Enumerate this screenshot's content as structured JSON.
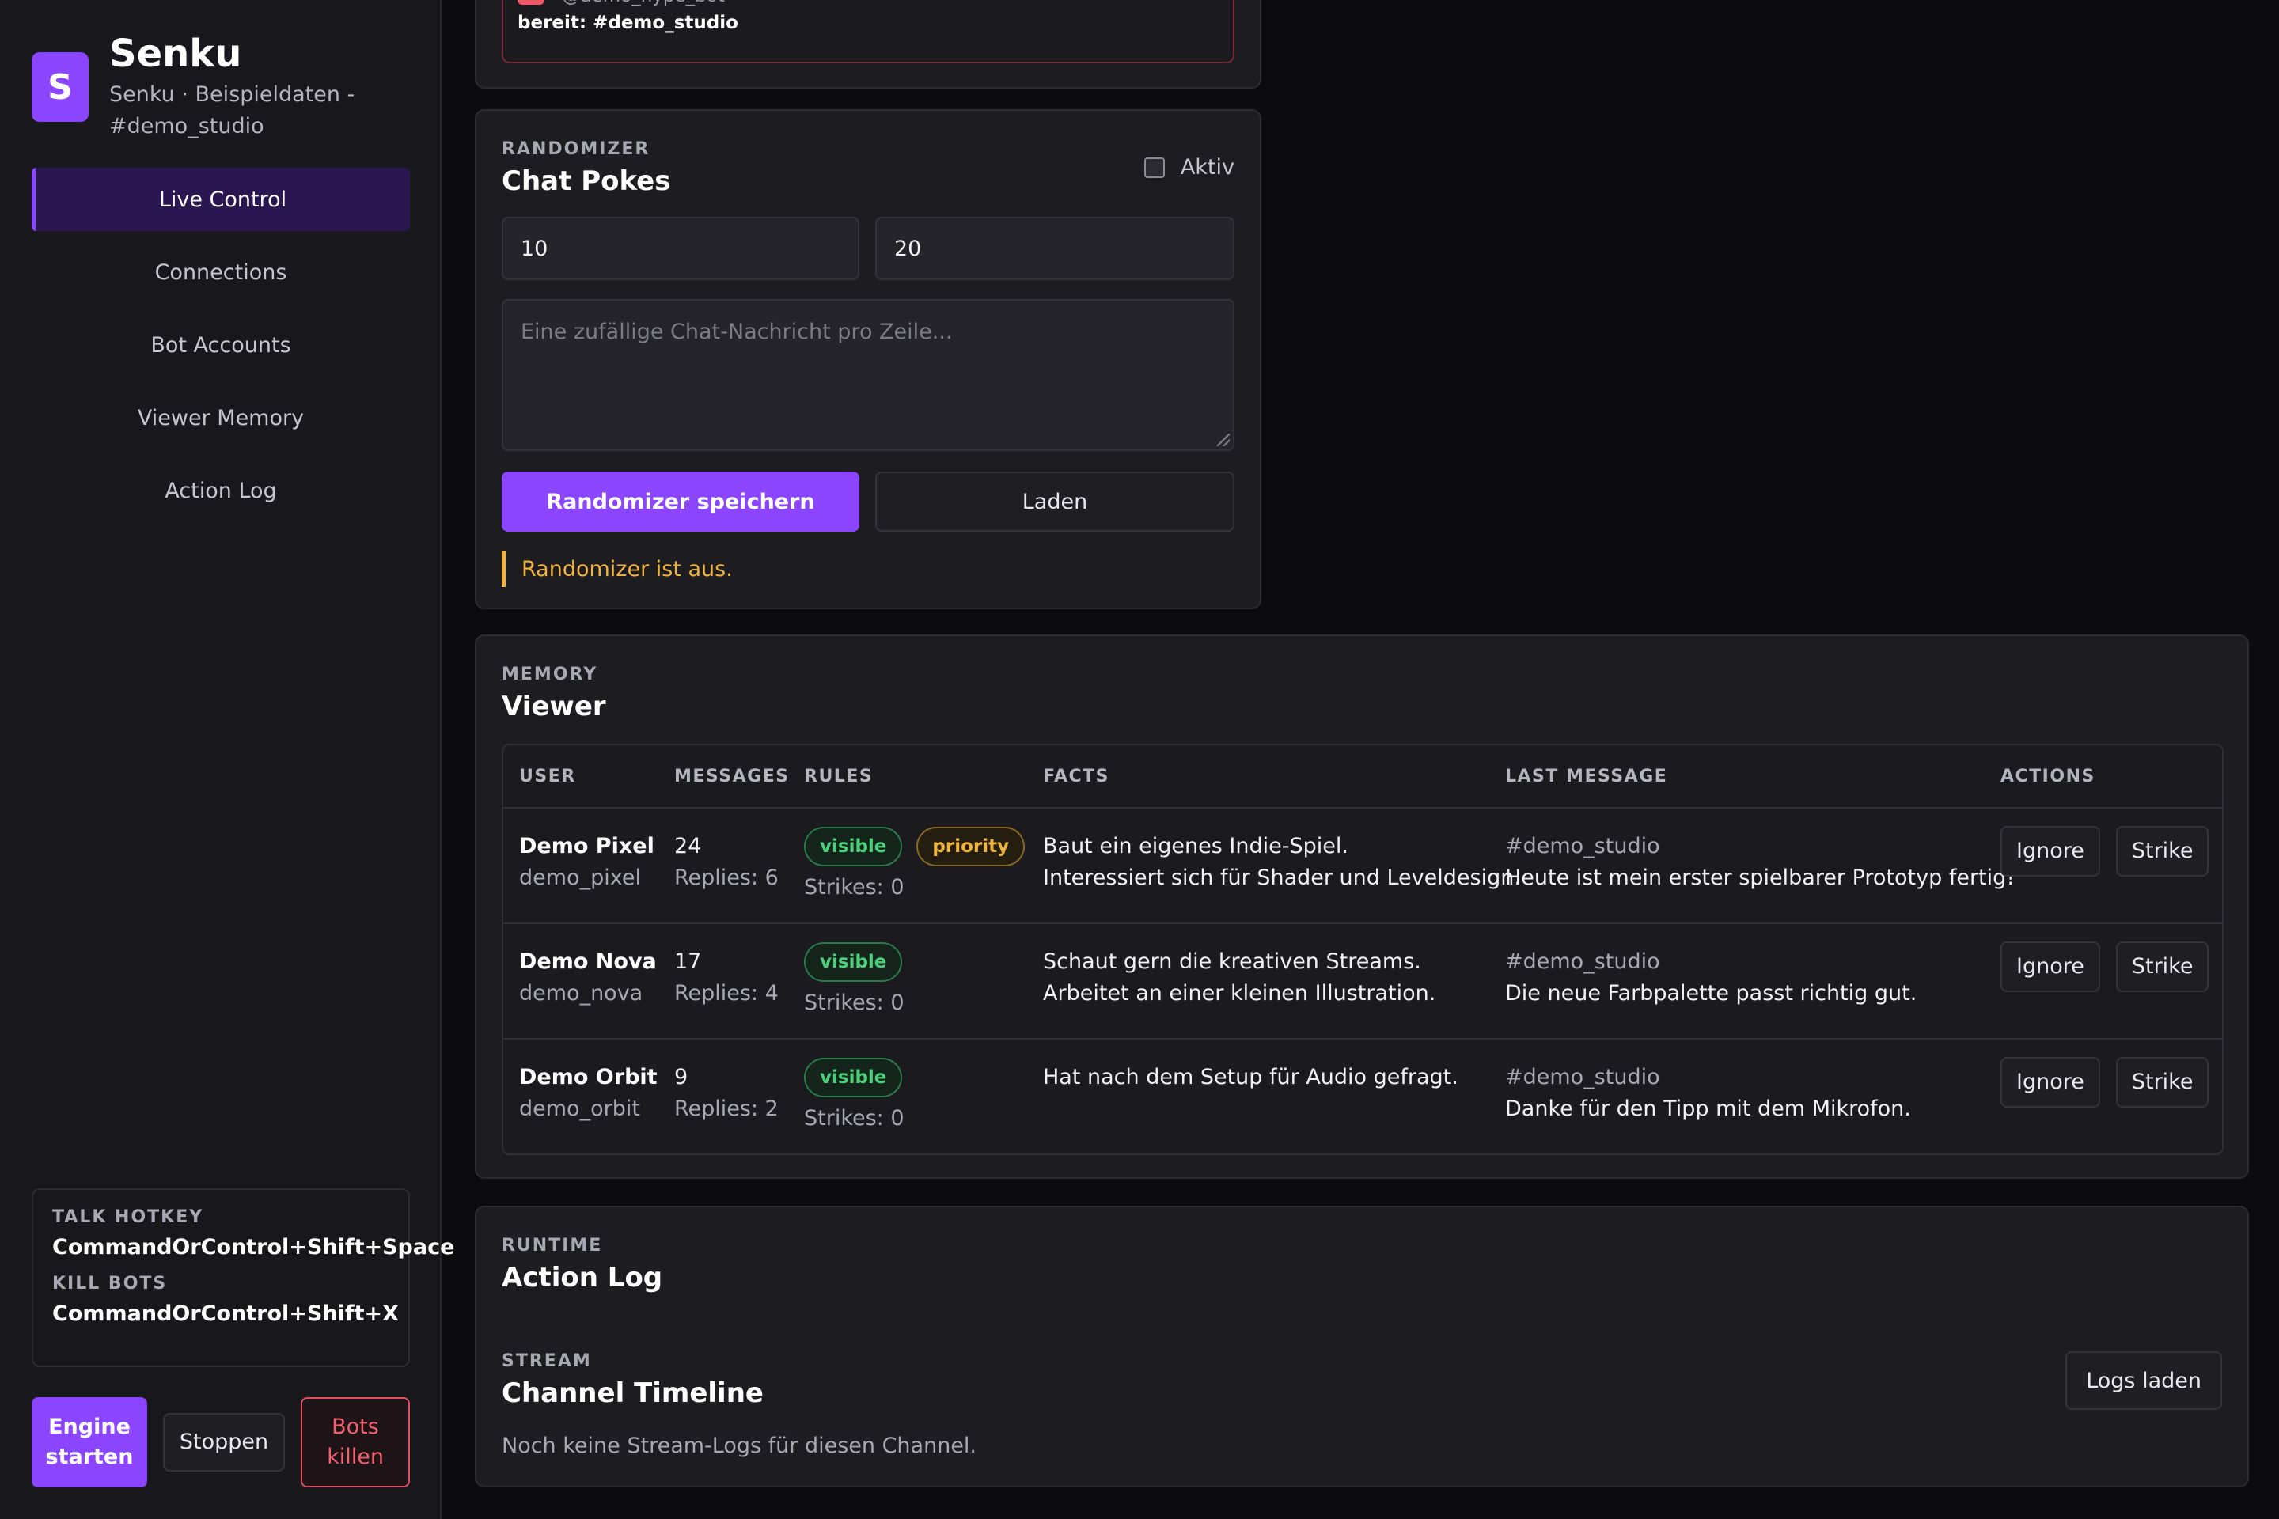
{
  "app": {
    "logo_letter": "S",
    "title": "Senku",
    "subtitle": "Senku · Beispieldaten - #demo_studio"
  },
  "nav": {
    "items": [
      "Live Control",
      "Connections",
      "Bot Accounts",
      "Viewer Memory",
      "Action Log"
    ],
    "active": "Live Control"
  },
  "hotkeys": {
    "talk_label": "TALK HOTKEY",
    "talk_value": "CommandOrControl+Shift+Space",
    "kill_label": "KILL BOTS",
    "kill_value": "CommandOrControl+Shift+X"
  },
  "engine_buttons": {
    "start": "Engine starten",
    "stop": "Stoppen",
    "kill": "Bots killen"
  },
  "bot_status": {
    "handle": "@demo_hype_bot",
    "ready": "bereit: #demo_studio"
  },
  "randomizer": {
    "eyebrow": "RANDOMIZER",
    "title": "Chat Pokes",
    "active_label": "Aktiv",
    "active_checked": false,
    "min_value": "10",
    "max_value": "20",
    "messages_placeholder": "Eine zufällige Chat-Nachricht pro Zeile...",
    "save_label": "Randomizer speichern",
    "load_label": "Laden",
    "status": "Randomizer ist aus."
  },
  "memory": {
    "eyebrow": "MEMORY",
    "title": "Viewer",
    "columns": [
      "USER",
      "MESSAGES",
      "RULES",
      "FACTS",
      "LAST MESSAGE",
      "ACTIONS"
    ],
    "rows": [
      {
        "name": "Demo Pixel",
        "login": "demo_pixel",
        "messages": "24",
        "replies": "Replies: 6",
        "badges": [
          "visible",
          "priority"
        ],
        "strikes": "Strikes: 0",
        "facts": [
          "Baut ein eigenes Indie-Spiel.",
          "Interessiert sich für Shader und Leveldesign."
        ],
        "last_channel": "#demo_studio",
        "last_message": "Heute ist mein erster spielbarer Prototyp fertig!"
      },
      {
        "name": "Demo Nova",
        "login": "demo_nova",
        "messages": "17",
        "replies": "Replies: 4",
        "badges": [
          "visible"
        ],
        "strikes": "Strikes: 0",
        "facts": [
          "Schaut gern die kreativen Streams.",
          "Arbeitet an einer kleinen Illustration."
        ],
        "last_channel": "#demo_studio",
        "last_message": "Die neue Farbpalette passt richtig gut."
      },
      {
        "name": "Demo Orbit",
        "login": "demo_orbit",
        "messages": "9",
        "replies": "Replies: 2",
        "badges": [
          "visible"
        ],
        "strikes": "Strikes: 0",
        "facts": [
          "Hat nach dem Setup für Audio gefragt."
        ],
        "last_channel": "#demo_studio",
        "last_message": "Danke für den Tipp mit dem Mikrofon."
      }
    ],
    "actions": [
      "Ignore",
      "Strike"
    ]
  },
  "runtime": {
    "eyebrow": "RUNTIME",
    "title": "Action Log",
    "stream_eyebrow": "STREAM",
    "stream_title": "Channel Timeline",
    "load_logs": "Logs laden",
    "empty": "Noch keine Stream-Logs für diesen Channel."
  },
  "colors": {
    "accent": "#8b45ff",
    "warning": "#f0b43c",
    "success": "#4ad07a",
    "danger": "#e14d5c",
    "background": "#0c0c0f",
    "panel": "#1c1c21"
  }
}
